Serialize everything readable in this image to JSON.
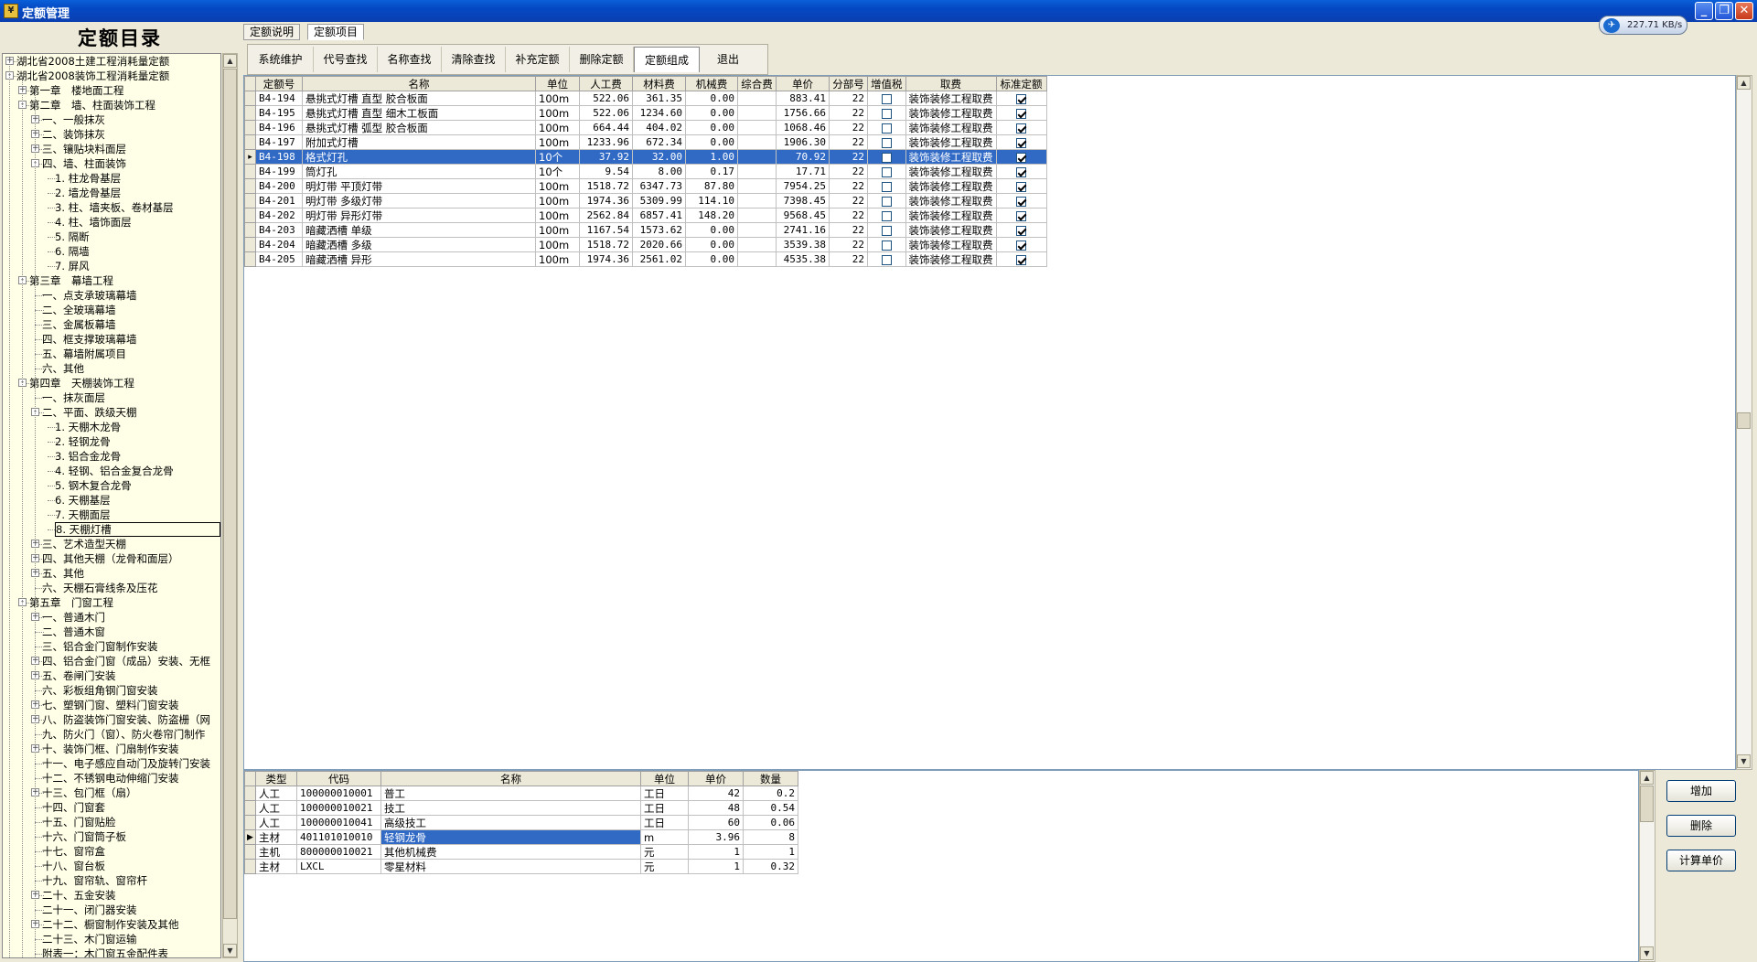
{
  "window": {
    "title": "定额管理",
    "net_speed": "227.71 KB/s"
  },
  "left": {
    "header": "定额目录",
    "tree": [
      {
        "t": "湖北省2008土建工程消耗量定额",
        "l": 0,
        "box": "+"
      },
      {
        "t": "湖北省2008装饰工程消耗量定额",
        "l": 0,
        "box": "-"
      },
      {
        "t": "第一章　楼地面工程",
        "l": 1,
        "box": "+"
      },
      {
        "t": "第二章　墙、柱面装饰工程",
        "l": 1,
        "box": "-"
      },
      {
        "t": "一、一般抹灰",
        "l": 2,
        "box": "+"
      },
      {
        "t": "二、装饰抹灰",
        "l": 2,
        "box": "+"
      },
      {
        "t": "三、镶贴块料面层",
        "l": 2,
        "box": "+"
      },
      {
        "t": "四、墙、柱面装饰",
        "l": 2,
        "box": "-"
      },
      {
        "t": "1. 柱龙骨基层",
        "l": 3,
        "box": ""
      },
      {
        "t": "2. 墙龙骨基层",
        "l": 3,
        "box": ""
      },
      {
        "t": "3. 柱、墙夹板、卷材基层",
        "l": 3,
        "box": ""
      },
      {
        "t": "4. 柱、墙饰面层",
        "l": 3,
        "box": ""
      },
      {
        "t": "5. 隔断",
        "l": 3,
        "box": ""
      },
      {
        "t": "6. 隔墙",
        "l": 3,
        "box": ""
      },
      {
        "t": "7. 屏风",
        "l": 3,
        "box": ""
      },
      {
        "t": "第三章　幕墙工程",
        "l": 1,
        "box": "-"
      },
      {
        "t": "一、点支承玻璃幕墙",
        "l": 2,
        "box": ""
      },
      {
        "t": "二、全玻璃幕墙",
        "l": 2,
        "box": ""
      },
      {
        "t": "三、金属板幕墙",
        "l": 2,
        "box": ""
      },
      {
        "t": "四、框支撑玻璃幕墙",
        "l": 2,
        "box": ""
      },
      {
        "t": "五、幕墙附属项目",
        "l": 2,
        "box": ""
      },
      {
        "t": "六、其他",
        "l": 2,
        "box": ""
      },
      {
        "t": "第四章　天棚装饰工程",
        "l": 1,
        "box": "-"
      },
      {
        "t": "一、抹灰面层",
        "l": 2,
        "box": ""
      },
      {
        "t": "二、平面、跌级天棚",
        "l": 2,
        "box": "-"
      },
      {
        "t": "1. 天棚木龙骨",
        "l": 3,
        "box": ""
      },
      {
        "t": "2. 轻钢龙骨",
        "l": 3,
        "box": ""
      },
      {
        "t": "3. 铝合金龙骨",
        "l": 3,
        "box": ""
      },
      {
        "t": "4. 轻钢、铝合金复合龙骨",
        "l": 3,
        "box": ""
      },
      {
        "t": "5. 钢木复合龙骨",
        "l": 3,
        "box": ""
      },
      {
        "t": "6. 天棚基层",
        "l": 3,
        "box": ""
      },
      {
        "t": "7. 天棚面层",
        "l": 3,
        "box": ""
      },
      {
        "t": "8. 天棚灯槽",
        "l": 3,
        "box": "",
        "sel": true
      },
      {
        "t": "三、艺术造型天棚",
        "l": 2,
        "box": "+"
      },
      {
        "t": "四、其他天棚（龙骨和面层）",
        "l": 2,
        "box": "+"
      },
      {
        "t": "五、其他",
        "l": 2,
        "box": "+"
      },
      {
        "t": "六、天棚石膏线条及压花",
        "l": 2,
        "box": ""
      },
      {
        "t": "第五章　门窗工程",
        "l": 1,
        "box": "-"
      },
      {
        "t": "一、普通木门",
        "l": 2,
        "box": "+"
      },
      {
        "t": "二、普通木窗",
        "l": 2,
        "box": ""
      },
      {
        "t": "三、铝合金门窗制作安装",
        "l": 2,
        "box": ""
      },
      {
        "t": "四、铝合金门窗（成品）安装、无框",
        "l": 2,
        "box": "+"
      },
      {
        "t": "五、卷闸门安装",
        "l": 2,
        "box": "+"
      },
      {
        "t": "六、彩板组角钢门窗安装",
        "l": 2,
        "box": ""
      },
      {
        "t": "七、塑钢门窗、塑料门窗安装",
        "l": 2,
        "box": "+"
      },
      {
        "t": "八、防盗装饰门窗安装、防盗栅（网",
        "l": 2,
        "box": "+"
      },
      {
        "t": "九、防火门（窗）、防火卷帘门制作",
        "l": 2,
        "box": ""
      },
      {
        "t": "十、装饰门框、门扇制作安装",
        "l": 2,
        "box": "+"
      },
      {
        "t": "十一、电子感应自动门及旋转门安装",
        "l": 2,
        "box": ""
      },
      {
        "t": "十二、不锈钢电动伸缩门安装",
        "l": 2,
        "box": ""
      },
      {
        "t": "十三、包门框（扇）",
        "l": 2,
        "box": "+"
      },
      {
        "t": "十四、门窗套",
        "l": 2,
        "box": ""
      },
      {
        "t": "十五、门窗贴脸",
        "l": 2,
        "box": ""
      },
      {
        "t": "十六、门窗筒子板",
        "l": 2,
        "box": ""
      },
      {
        "t": "十七、窗帘盒",
        "l": 2,
        "box": ""
      },
      {
        "t": "十八、窗台板",
        "l": 2,
        "box": ""
      },
      {
        "t": "十九、窗帘轨、窗帘杆",
        "l": 2,
        "box": ""
      },
      {
        "t": "二十、五金安装",
        "l": 2,
        "box": "+"
      },
      {
        "t": "二十一、闭门器安装",
        "l": 2,
        "box": ""
      },
      {
        "t": "二十二、橱窗制作安装及其他",
        "l": 2,
        "box": "+"
      },
      {
        "t": "二十三、木门窗运输",
        "l": 2,
        "box": ""
      },
      {
        "t": "附表一：木门窗五金配件表",
        "l": 2,
        "box": ""
      }
    ]
  },
  "top_tabs": [
    "定额说明",
    "定额项目"
  ],
  "toolbar": [
    "系统维护",
    "代号查找",
    "名称查找",
    "清除查找",
    "补充定额",
    "删除定额",
    "定额组成",
    "退出"
  ],
  "quota_grid": {
    "columns": [
      "定额号",
      "名称",
      "单位",
      "人工费",
      "材料费",
      "机械费",
      "综合费",
      "单价",
      "分部号",
      "增值税",
      "取费",
      "标准定额"
    ],
    "rows": [
      {
        "id": "B4-194",
        "name": "悬挑式灯槽 直型 胶合板面",
        "unit": "100m",
        "labor": "522.06",
        "material": "361.35",
        "machine": "0.00",
        "comp": "",
        "price": "883.41",
        "part": "22",
        "vat": false,
        "fee": "装饰装修工程取费",
        "std": true
      },
      {
        "id": "B4-195",
        "name": "悬挑式灯槽 直型 细木工板面",
        "unit": "100m",
        "labor": "522.06",
        "material": "1234.60",
        "machine": "0.00",
        "comp": "",
        "price": "1756.66",
        "part": "22",
        "vat": false,
        "fee": "装饰装修工程取费",
        "std": true
      },
      {
        "id": "B4-196",
        "name": "悬挑式灯槽 弧型 胶合板面",
        "unit": "100m",
        "labor": "664.44",
        "material": "404.02",
        "machine": "0.00",
        "comp": "",
        "price": "1068.46",
        "part": "22",
        "vat": false,
        "fee": "装饰装修工程取费",
        "std": true
      },
      {
        "id": "B4-197",
        "name": "附加式灯槽",
        "unit": "100m",
        "labor": "1233.96",
        "material": "672.34",
        "machine": "0.00",
        "comp": "",
        "price": "1906.30",
        "part": "22",
        "vat": false,
        "fee": "装饰装修工程取费",
        "std": true
      },
      {
        "id": "B4-198",
        "name": "格式灯孔",
        "unit": "10个",
        "labor": "37.92",
        "material": "32.00",
        "machine": "1.00",
        "comp": "",
        "price": "70.92",
        "part": "22",
        "vat": false,
        "fee": "装饰装修工程取费",
        "std": true,
        "sel": true
      },
      {
        "id": "B4-199",
        "name": "筒灯孔",
        "unit": "10个",
        "labor": "9.54",
        "material": "8.00",
        "machine": "0.17",
        "comp": "",
        "price": "17.71",
        "part": "22",
        "vat": false,
        "fee": "装饰装修工程取费",
        "std": true
      },
      {
        "id": "B4-200",
        "name": "明灯带 平顶灯带",
        "unit": "100m",
        "labor": "1518.72",
        "material": "6347.73",
        "machine": "87.80",
        "comp": "",
        "price": "7954.25",
        "part": "22",
        "vat": false,
        "fee": "装饰装修工程取费",
        "std": true
      },
      {
        "id": "B4-201",
        "name": "明灯带 多级灯带",
        "unit": "100m",
        "labor": "1974.36",
        "material": "5309.99",
        "machine": "114.10",
        "comp": "",
        "price": "7398.45",
        "part": "22",
        "vat": false,
        "fee": "装饰装修工程取费",
        "std": true
      },
      {
        "id": "B4-202",
        "name": "明灯带 异形灯带",
        "unit": "100m",
        "labor": "2562.84",
        "material": "6857.41",
        "machine": "148.20",
        "comp": "",
        "price": "9568.45",
        "part": "22",
        "vat": false,
        "fee": "装饰装修工程取费",
        "std": true
      },
      {
        "id": "B4-203",
        "name": "暗藏洒槽 单级",
        "unit": "100m",
        "labor": "1167.54",
        "material": "1573.62",
        "machine": "0.00",
        "comp": "",
        "price": "2741.16",
        "part": "22",
        "vat": false,
        "fee": "装饰装修工程取费",
        "std": true
      },
      {
        "id": "B4-204",
        "name": "暗藏洒槽 多级",
        "unit": "100m",
        "labor": "1518.72",
        "material": "2020.66",
        "machine": "0.00",
        "comp": "",
        "price": "3539.38",
        "part": "22",
        "vat": false,
        "fee": "装饰装修工程取费",
        "std": true
      },
      {
        "id": "B4-205",
        "name": "暗藏洒槽 异形",
        "unit": "100m",
        "labor": "1974.36",
        "material": "2561.02",
        "machine": "0.00",
        "comp": "",
        "price": "4535.38",
        "part": "22",
        "vat": false,
        "fee": "装饰装修工程取费",
        "std": true
      }
    ]
  },
  "composition_grid": {
    "columns": [
      "类型",
      "代码",
      "名称",
      "单位",
      "单价",
      "数量"
    ],
    "rows": [
      {
        "type": "人工",
        "code": "100000010001",
        "name": "普工",
        "unit": "工日",
        "price": "42",
        "qty": "0.2"
      },
      {
        "type": "人工",
        "code": "100000010021",
        "name": "技工",
        "unit": "工日",
        "price": "48",
        "qty": "0.54"
      },
      {
        "type": "人工",
        "code": "100000010041",
        "name": "高级技工",
        "unit": "工日",
        "price": "60",
        "qty": "0.06"
      },
      {
        "type": "主材",
        "code": "401101010010",
        "name": "轻钢龙骨",
        "unit": "m",
        "price": "3.96",
        "qty": "8",
        "sel": true
      },
      {
        "type": "主机",
        "code": "800000010021",
        "name": "其他机械费",
        "unit": "元",
        "price": "1",
        "qty": "1"
      },
      {
        "type": "主材",
        "code": "LXCL",
        "name": "零星材料",
        "unit": "元",
        "price": "1",
        "qty": "0.32"
      }
    ]
  },
  "buttons": {
    "add": "增加",
    "delete": "删除",
    "calc": "计算单价"
  }
}
